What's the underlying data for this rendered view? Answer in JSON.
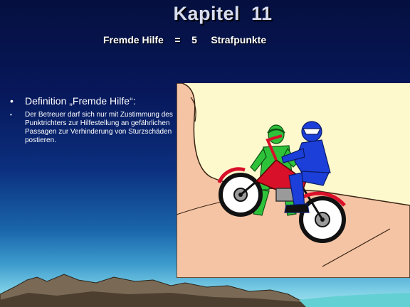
{
  "slide": {
    "title": "Kapitel  11",
    "subtitle": "Fremde Hilfe    =    5     Strafpunkte",
    "bullet_main": "Definition „Fremde Hilfe“:",
    "bullet_sub": "Der Betreuer darf sich nur mit Zustimmung des Punktrichters zur Hilfestellung an gefährlichen Passagen zur Verhinderung von Sturzschäden postieren.",
    "bullet_symbol": "•"
  },
  "colors": {
    "background_top": "#05103f",
    "background_bottom": "#a6e2ee",
    "picture_background": "#fdf9cd",
    "rock": "#f4c4a4",
    "helper_green": "#2ec23a",
    "rider_blue": "#1b3fd8",
    "bike_red": "#d8102a"
  },
  "picture": {
    "subject": "trial motorcycle rider assisted by helper on rock",
    "icons": [
      "helper-figure-icon",
      "rider-figure-icon",
      "motorcycle-icon"
    ]
  }
}
